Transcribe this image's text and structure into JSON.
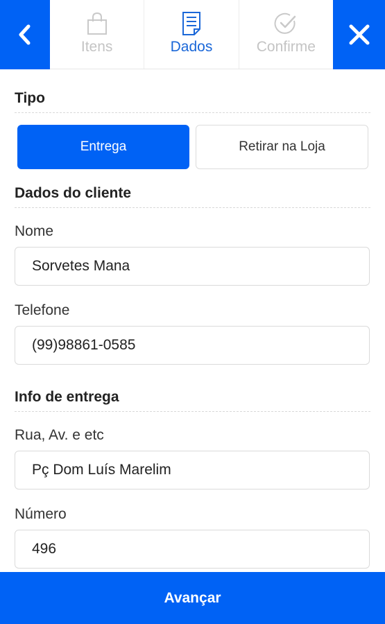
{
  "nav": {
    "back_icon": "chevron-left-icon",
    "close_icon": "close-icon",
    "accent_color": "#0062f5"
  },
  "steps": [
    {
      "label": "Itens",
      "icon": "shopping-bag-icon",
      "state": "inactive"
    },
    {
      "label": "Dados",
      "icon": "document-icon",
      "state": "active"
    },
    {
      "label": "Confirme",
      "icon": "check-circle-icon",
      "state": "inactive"
    }
  ],
  "tipo": {
    "title": "Tipo",
    "options": [
      "Entrega",
      "Retirar na Loja"
    ],
    "selected": "Entrega"
  },
  "cliente": {
    "title": "Dados do cliente",
    "nome_label": "Nome",
    "nome_value": "Sorvetes Mana",
    "telefone_label": "Telefone",
    "telefone_value": "(99)98861-0585"
  },
  "entrega": {
    "title": "Info de entrega",
    "rua_label": "Rua, Av. e etc",
    "rua_value": "Pç Dom Luís Marelim",
    "numero_label": "Número",
    "numero_value": "496"
  },
  "footer": {
    "next_label": "Avançar"
  }
}
